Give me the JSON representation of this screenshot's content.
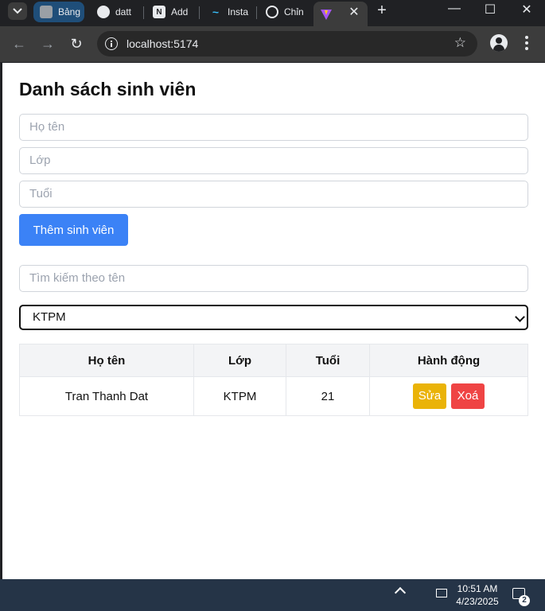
{
  "browser": {
    "tabs": [
      {
        "label": "Bảng",
        "favicon": "sheet-icon",
        "color": "#1f4e79"
      },
      {
        "label": "datt",
        "favicon": "github-icon"
      },
      {
        "label": "Add",
        "favicon": "vercel-icon"
      },
      {
        "label": "Insta",
        "favicon": "tailwind-icon"
      },
      {
        "label": "Chỉn",
        "favicon": "chrome-icon"
      },
      {
        "label": "",
        "favicon": "vite-icon",
        "active": true
      }
    ],
    "url": "localhost:5174"
  },
  "app": {
    "title": "Danh sách sinh viên",
    "form": {
      "name_placeholder": "Họ tên",
      "class_placeholder": "Lớp",
      "age_placeholder": "Tuổi",
      "add_button": "Thêm sinh viên"
    },
    "search_placeholder": "Tìm kiếm theo tên",
    "class_filter": "KTPM",
    "table": {
      "headers": [
        "Họ tên",
        "Lớp",
        "Tuổi",
        "Hành động"
      ],
      "rows": [
        {
          "name": "Tran Thanh Dat",
          "class": "KTPM",
          "age": "21",
          "edit": "Sửa",
          "delete": "Xoá"
        }
      ]
    }
  },
  "taskbar": {
    "time": "10:51 AM",
    "date": "4/23/2025",
    "notifications": "2"
  },
  "colors": {
    "primary": "#3b82f6",
    "edit": "#eab308",
    "delete": "#ef4444"
  }
}
